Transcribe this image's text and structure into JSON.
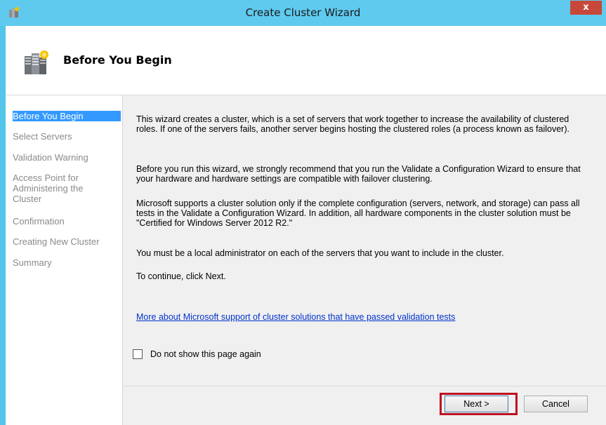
{
  "window": {
    "title": "Create Cluster Wizard",
    "close_label": "x",
    "accent_color": "#5fcaee"
  },
  "header": {
    "title": "Before You Begin",
    "icon": "cluster-servers-icon"
  },
  "nav": {
    "items": [
      {
        "label": "Before You Begin",
        "selected": true
      },
      {
        "label": "Select Servers",
        "selected": false
      },
      {
        "label": "Validation Warning",
        "selected": false
      },
      {
        "label": "Access Point for Administering the Cluster",
        "selected": false
      },
      {
        "label": "Confirmation",
        "selected": false
      },
      {
        "label": "Creating New Cluster",
        "selected": false
      },
      {
        "label": "Summary",
        "selected": false
      }
    ]
  },
  "content": {
    "paragraphs": [
      "This wizard creates a cluster, which is a set of servers that work together to increase the availability of clustered roles. If one of the servers fails, another server begins hosting the clustered roles (a process known as failover).",
      "Before you run this wizard, we strongly recommend that you run the Validate a Configuration Wizard to ensure that your hardware and hardware settings are compatible with failover clustering.",
      "Microsoft supports a cluster solution only if the complete configuration (servers, network, and storage) can pass all tests in the Validate a Configuration Wizard. In addition, all hardware components in the cluster solution must be \"Certified for Windows Server 2012 R2.\"",
      "You must be a local administrator on each of the servers that you want to include in the cluster.",
      "To continue, click Next."
    ],
    "link_text": "More about Microsoft support of cluster solutions that have passed validation tests",
    "checkbox_label": "Do not show this page again",
    "checkbox_checked": false
  },
  "buttons": {
    "next": "Next >",
    "cancel": "Cancel"
  }
}
